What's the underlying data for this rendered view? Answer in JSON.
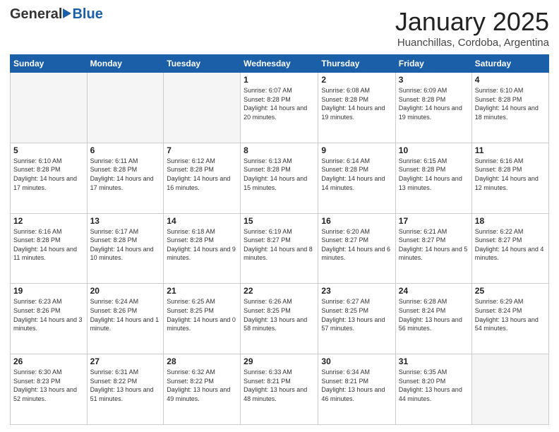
{
  "header": {
    "logo_general": "General",
    "logo_blue": "Blue",
    "month_title": "January 2025",
    "subtitle": "Huanchillas, Cordoba, Argentina"
  },
  "days_of_week": [
    "Sunday",
    "Monday",
    "Tuesday",
    "Wednesday",
    "Thursday",
    "Friday",
    "Saturday"
  ],
  "weeks": [
    [
      {
        "day": "",
        "info": ""
      },
      {
        "day": "",
        "info": ""
      },
      {
        "day": "",
        "info": ""
      },
      {
        "day": "1",
        "info": "Sunrise: 6:07 AM\nSunset: 8:28 PM\nDaylight: 14 hours\nand 20 minutes."
      },
      {
        "day": "2",
        "info": "Sunrise: 6:08 AM\nSunset: 8:28 PM\nDaylight: 14 hours\nand 19 minutes."
      },
      {
        "day": "3",
        "info": "Sunrise: 6:09 AM\nSunset: 8:28 PM\nDaylight: 14 hours\nand 19 minutes."
      },
      {
        "day": "4",
        "info": "Sunrise: 6:10 AM\nSunset: 8:28 PM\nDaylight: 14 hours\nand 18 minutes."
      }
    ],
    [
      {
        "day": "5",
        "info": "Sunrise: 6:10 AM\nSunset: 8:28 PM\nDaylight: 14 hours\nand 17 minutes."
      },
      {
        "day": "6",
        "info": "Sunrise: 6:11 AM\nSunset: 8:28 PM\nDaylight: 14 hours\nand 17 minutes."
      },
      {
        "day": "7",
        "info": "Sunrise: 6:12 AM\nSunset: 8:28 PM\nDaylight: 14 hours\nand 16 minutes."
      },
      {
        "day": "8",
        "info": "Sunrise: 6:13 AM\nSunset: 8:28 PM\nDaylight: 14 hours\nand 15 minutes."
      },
      {
        "day": "9",
        "info": "Sunrise: 6:14 AM\nSunset: 8:28 PM\nDaylight: 14 hours\nand 14 minutes."
      },
      {
        "day": "10",
        "info": "Sunrise: 6:15 AM\nSunset: 8:28 PM\nDaylight: 14 hours\nand 13 minutes."
      },
      {
        "day": "11",
        "info": "Sunrise: 6:16 AM\nSunset: 8:28 PM\nDaylight: 14 hours\nand 12 minutes."
      }
    ],
    [
      {
        "day": "12",
        "info": "Sunrise: 6:16 AM\nSunset: 8:28 PM\nDaylight: 14 hours\nand 11 minutes."
      },
      {
        "day": "13",
        "info": "Sunrise: 6:17 AM\nSunset: 8:28 PM\nDaylight: 14 hours\nand 10 minutes."
      },
      {
        "day": "14",
        "info": "Sunrise: 6:18 AM\nSunset: 8:28 PM\nDaylight: 14 hours\nand 9 minutes."
      },
      {
        "day": "15",
        "info": "Sunrise: 6:19 AM\nSunset: 8:27 PM\nDaylight: 14 hours\nand 8 minutes."
      },
      {
        "day": "16",
        "info": "Sunrise: 6:20 AM\nSunset: 8:27 PM\nDaylight: 14 hours\nand 6 minutes."
      },
      {
        "day": "17",
        "info": "Sunrise: 6:21 AM\nSunset: 8:27 PM\nDaylight: 14 hours\nand 5 minutes."
      },
      {
        "day": "18",
        "info": "Sunrise: 6:22 AM\nSunset: 8:27 PM\nDaylight: 14 hours\nand 4 minutes."
      }
    ],
    [
      {
        "day": "19",
        "info": "Sunrise: 6:23 AM\nSunset: 8:26 PM\nDaylight: 14 hours\nand 3 minutes."
      },
      {
        "day": "20",
        "info": "Sunrise: 6:24 AM\nSunset: 8:26 PM\nDaylight: 14 hours\nand 1 minute."
      },
      {
        "day": "21",
        "info": "Sunrise: 6:25 AM\nSunset: 8:25 PM\nDaylight: 14 hours\nand 0 minutes."
      },
      {
        "day": "22",
        "info": "Sunrise: 6:26 AM\nSunset: 8:25 PM\nDaylight: 13 hours\nand 58 minutes."
      },
      {
        "day": "23",
        "info": "Sunrise: 6:27 AM\nSunset: 8:25 PM\nDaylight: 13 hours\nand 57 minutes."
      },
      {
        "day": "24",
        "info": "Sunrise: 6:28 AM\nSunset: 8:24 PM\nDaylight: 13 hours\nand 56 minutes."
      },
      {
        "day": "25",
        "info": "Sunrise: 6:29 AM\nSunset: 8:24 PM\nDaylight: 13 hours\nand 54 minutes."
      }
    ],
    [
      {
        "day": "26",
        "info": "Sunrise: 6:30 AM\nSunset: 8:23 PM\nDaylight: 13 hours\nand 52 minutes."
      },
      {
        "day": "27",
        "info": "Sunrise: 6:31 AM\nSunset: 8:22 PM\nDaylight: 13 hours\nand 51 minutes."
      },
      {
        "day": "28",
        "info": "Sunrise: 6:32 AM\nSunset: 8:22 PM\nDaylight: 13 hours\nand 49 minutes."
      },
      {
        "day": "29",
        "info": "Sunrise: 6:33 AM\nSunset: 8:21 PM\nDaylight: 13 hours\nand 48 minutes."
      },
      {
        "day": "30",
        "info": "Sunrise: 6:34 AM\nSunset: 8:21 PM\nDaylight: 13 hours\nand 46 minutes."
      },
      {
        "day": "31",
        "info": "Sunrise: 6:35 AM\nSunset: 8:20 PM\nDaylight: 13 hours\nand 44 minutes."
      },
      {
        "day": "",
        "info": ""
      }
    ]
  ]
}
